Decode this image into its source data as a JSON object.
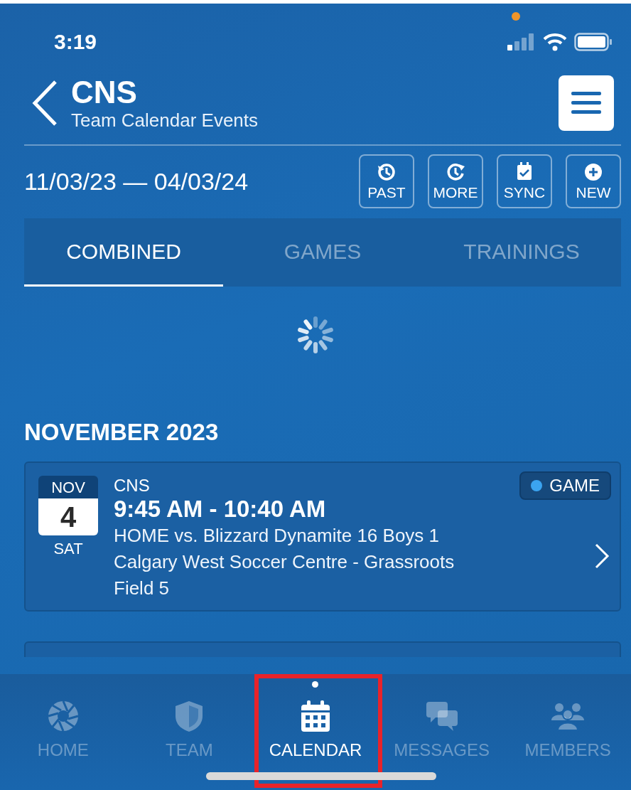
{
  "status_bar": {
    "time": "3:19",
    "recording": true
  },
  "header": {
    "title": "CNS",
    "subtitle": "Team Calendar Events"
  },
  "date_range": "11/03/23 — 04/03/24",
  "actions": [
    {
      "label": "PAST",
      "kind": "past"
    },
    {
      "label": "MORE",
      "kind": "more"
    },
    {
      "label": "SYNC",
      "kind": "sync"
    },
    {
      "label": "NEW",
      "kind": "new"
    }
  ],
  "tabs": [
    {
      "label": "COMBINED",
      "selected": true
    },
    {
      "label": "GAMES",
      "selected": false
    },
    {
      "label": "TRAININGS",
      "selected": false
    }
  ],
  "loading": true,
  "sections": [
    {
      "heading": "NOVEMBER 2023",
      "events": [
        {
          "kind": "event",
          "month": "NOV",
          "day": "4",
          "weekday": "SAT",
          "team": "CNS",
          "time": "9:45 AM - 10:40 AM",
          "lines": [
            "HOME vs. Blizzard Dynamite 16 Boys 1",
            "Calgary West Soccer Centre - Grassroots",
            "Field 5"
          ],
          "tag": {
            "label": "GAME",
            "color": "#3ba4f0"
          }
        },
        {
          "kind": "hidden"
        }
      ]
    }
  ],
  "nav": [
    {
      "label": "HOME",
      "kind": "home",
      "selected": false,
      "dot": false,
      "highlighted": false
    },
    {
      "label": "TEAM",
      "kind": "team",
      "selected": false,
      "dot": false,
      "highlighted": false
    },
    {
      "label": "CALENDAR",
      "kind": "calendar",
      "selected": true,
      "dot": true,
      "highlighted": true
    },
    {
      "label": "MESSAGES",
      "kind": "messages",
      "selected": false,
      "dot": false,
      "highlighted": false
    },
    {
      "label": "MEMBERS",
      "kind": "members",
      "selected": false,
      "dot": false,
      "highlighted": false
    }
  ]
}
